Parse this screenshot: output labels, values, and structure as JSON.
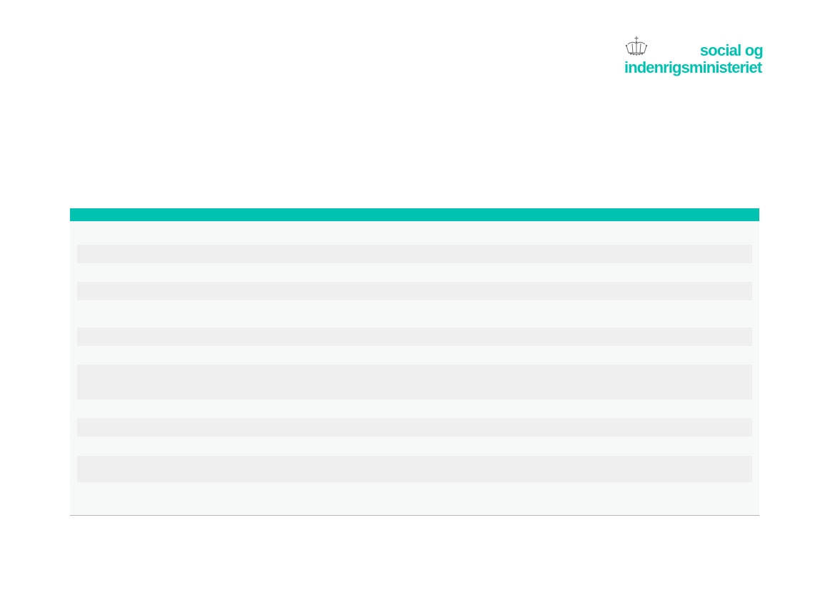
{
  "logo": {
    "line1": "social og",
    "line2": "indenrigsministeriet",
    "icon": "crown-icon",
    "color": "#00c2b0"
  },
  "table": {
    "header_color": "#00c2b0",
    "stripe_color": "#efefef",
    "background_color": "#f7f8f8"
  }
}
